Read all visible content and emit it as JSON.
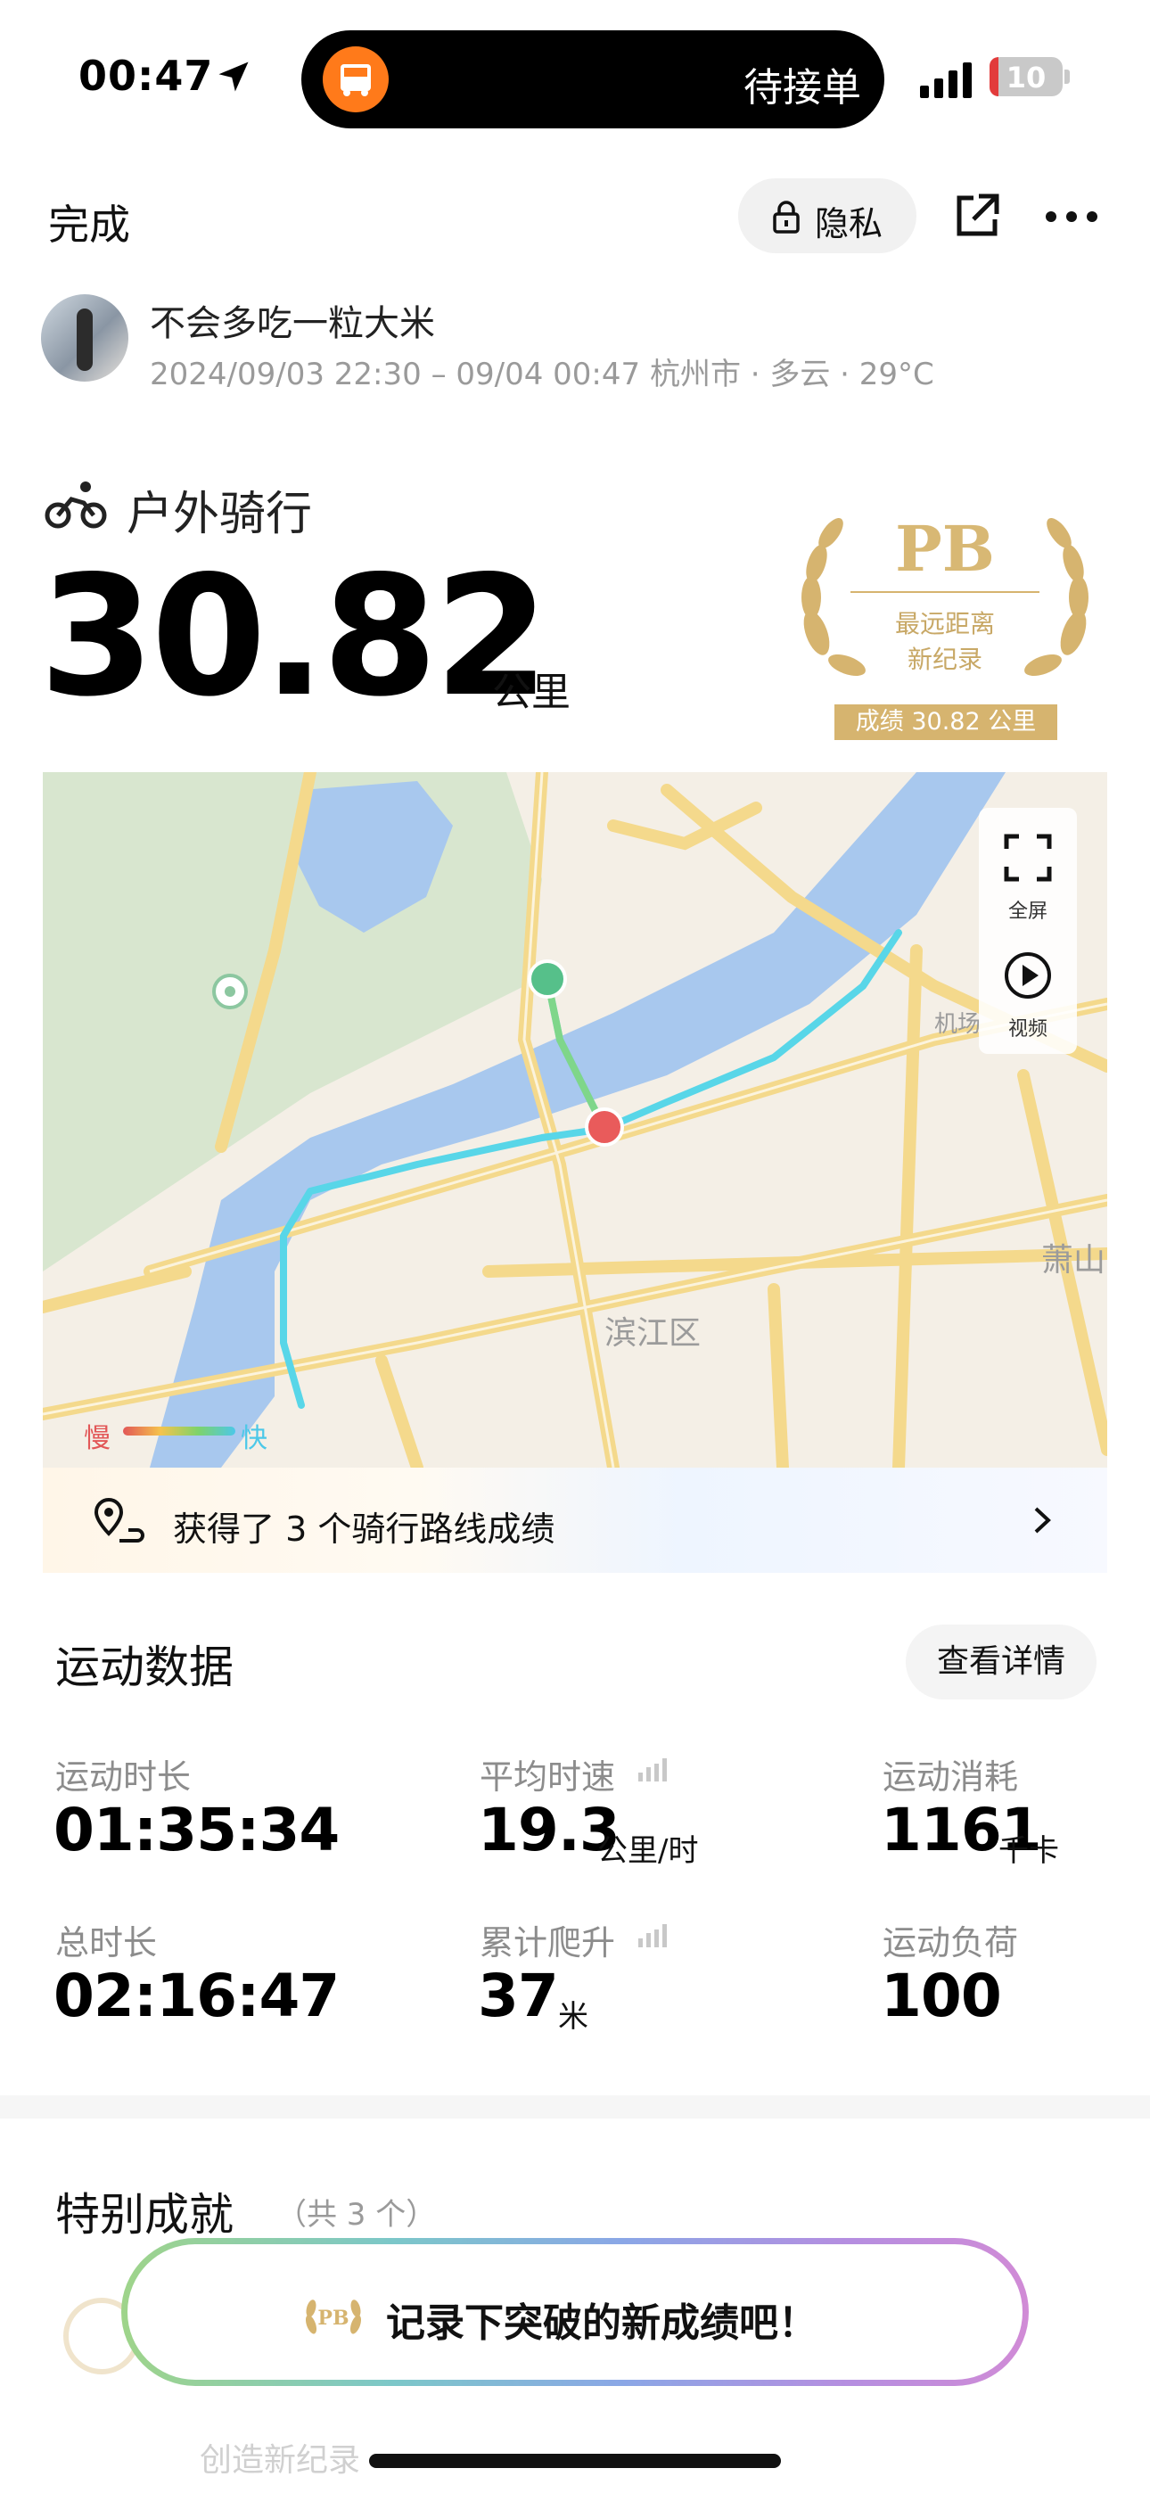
{
  "status_bar": {
    "time": "00:47",
    "island_text": "待接单",
    "battery": "10",
    "battery_color": "#e23b3b"
  },
  "header": {
    "done_label": "完成",
    "privacy_label": "隐私"
  },
  "user": {
    "name": "不会多吃一粒大米",
    "meta": "2024/09/03 22:30 – 09/04 00:47 杭州市 · 多云 · 29°C"
  },
  "activity": {
    "type": "户外骑行",
    "distance": "30.82",
    "distance_unit": "公里"
  },
  "pb_badge": {
    "title": "PB",
    "line1": "最远距离",
    "line2": "新纪录",
    "result": "成绩 30.82 公里",
    "color": "#d6b46f"
  },
  "map": {
    "fullscreen_label": "全屏",
    "video_label": "视频",
    "district_label": "滨江区",
    "road_label": "机场",
    "xiaoshan_label": "萧山",
    "legend_slow": "慢",
    "legend_fast": "快",
    "water_color": "#a8c8ee",
    "route_color": "#58d6e8"
  },
  "route_banner": {
    "text": "获得了 3 个骑行路线成绩"
  },
  "stats": {
    "title": "运动数据",
    "details_label": "查看详情",
    "items": [
      {
        "label": "运动时长",
        "value": "01:35:34",
        "unit": ""
      },
      {
        "label": "平均时速",
        "value": "19.3",
        "unit": "公里/时"
      },
      {
        "label": "运动消耗",
        "value": "1161",
        "unit": "千卡"
      },
      {
        "label": "总时长",
        "value": "02:16:47",
        "unit": ""
      },
      {
        "label": "累计爬升",
        "value": "37",
        "unit": "米"
      },
      {
        "label": "运动负荷",
        "value": "100",
        "unit": ""
      }
    ]
  },
  "achievements": {
    "title": "特别成就",
    "count": "（共 3 个）",
    "behind_text": "创造新纪录"
  },
  "toast": {
    "text": "记录下突破的新成绩吧！"
  }
}
